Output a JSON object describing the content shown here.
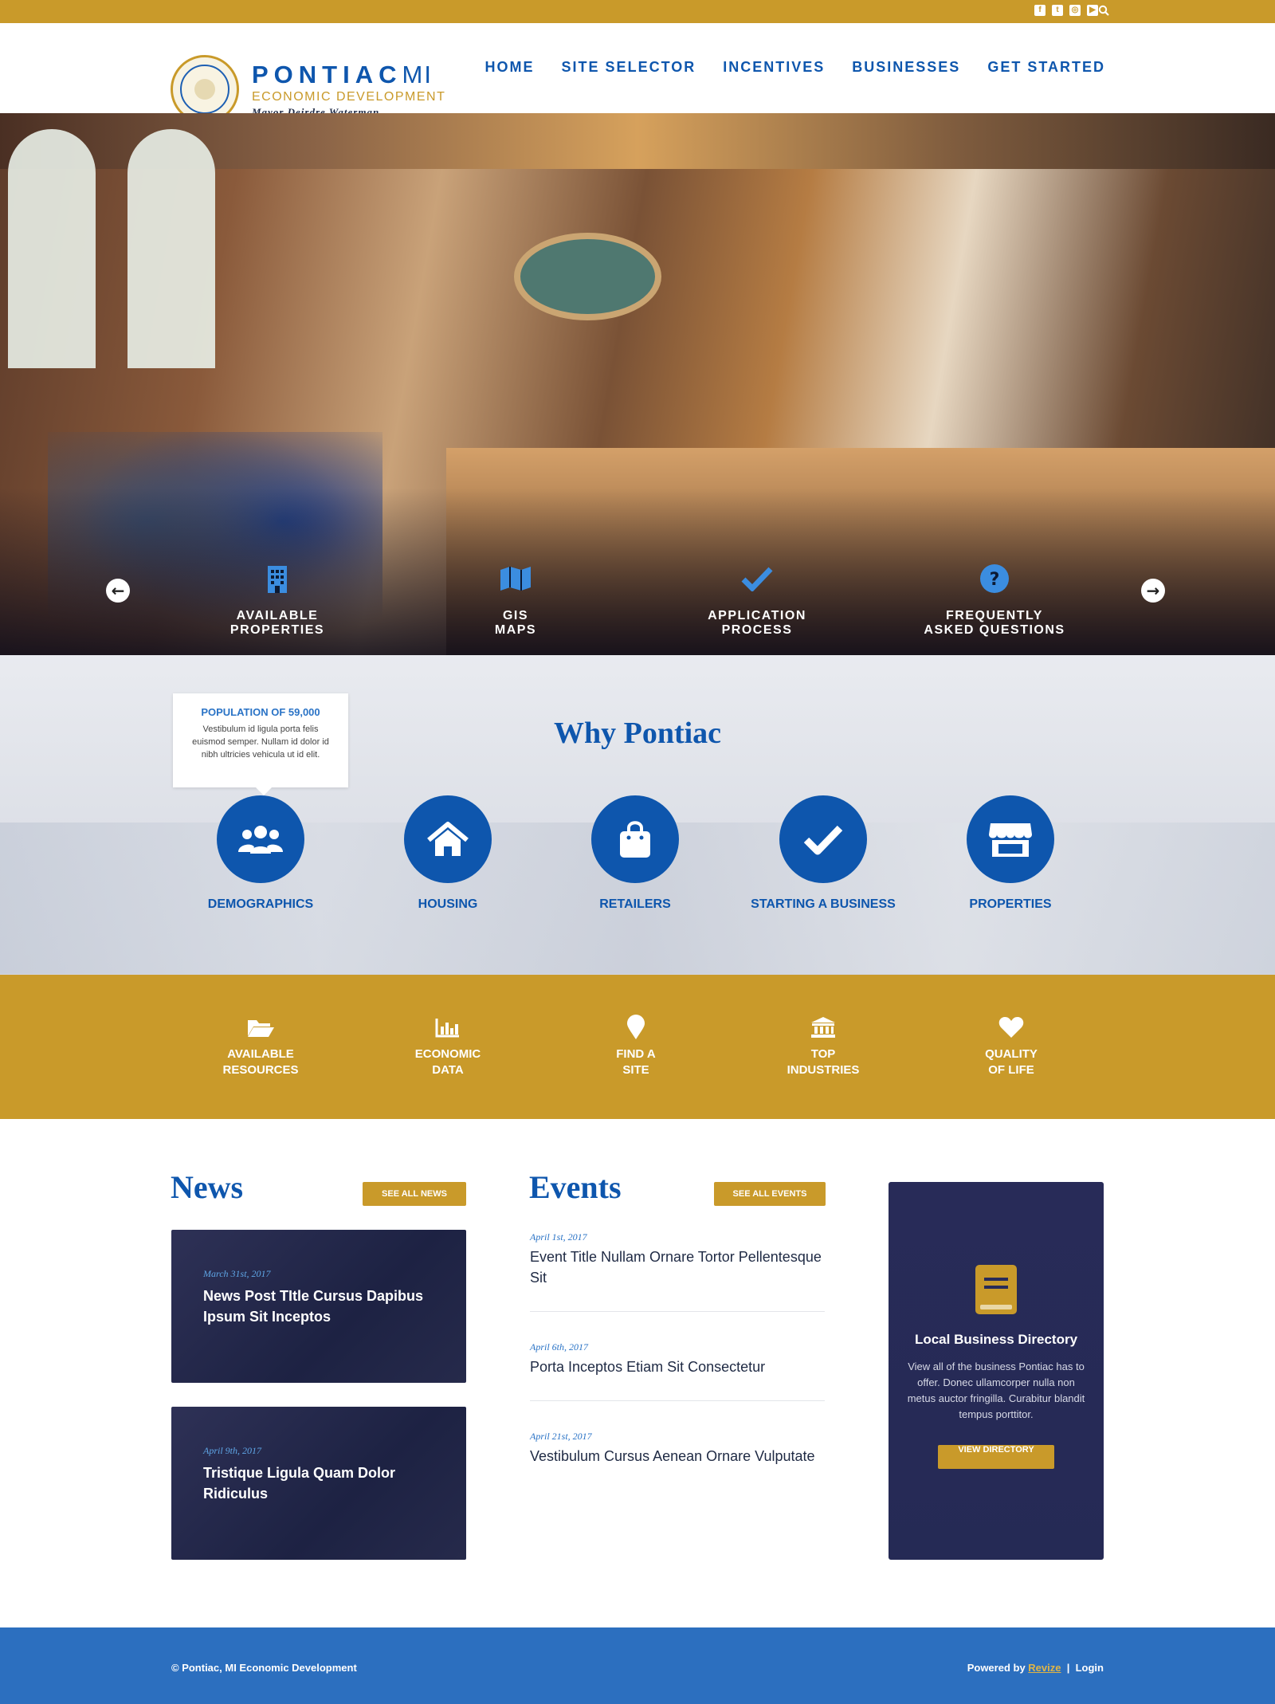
{
  "topbar": {
    "social": [
      "facebook-icon",
      "twitter-icon",
      "instagram-icon",
      "youtube-icon"
    ],
    "search_icon": "search-icon"
  },
  "header": {
    "brand_name": "PONTIAC",
    "brand_suffix": "MI",
    "brand_sub": "ECONOMIC DEVELOPMENT",
    "mayor": "Mayor Deirdre Waterman",
    "seal_alt": "THE CITY OF PONTIAC MICHIGAN"
  },
  "nav": [
    "HOME",
    "SITE SELECTOR",
    "INCENTIVES",
    "BUSINESSES",
    "GET STARTED"
  ],
  "hero_links": [
    {
      "line1": "AVAILABLE",
      "line2": "PROPERTIES",
      "icon": "building-icon"
    },
    {
      "line1": "GIS",
      "line2": "MAPS",
      "icon": "map-icon"
    },
    {
      "line1": "APPLICATION",
      "line2": "PROCESS",
      "icon": "checkmark-icon"
    },
    {
      "line1": "FREQUENTLY",
      "line2": "ASKED QUESTIONS",
      "icon": "question-icon"
    }
  ],
  "why": {
    "title": "Why Pontiac",
    "tooltip_title": "POPULATION OF 59,000",
    "tooltip_text": "Vestibulum id ligula porta felis euismod semper. Nullam id dolor id nibh ultricies vehicula ut id elit.",
    "items": [
      {
        "label": "DEMOGRAPHICS",
        "icon": "users-icon"
      },
      {
        "label": "HOUSING",
        "icon": "home-icon"
      },
      {
        "label": "RETAILERS",
        "icon": "shopping-bag-icon"
      },
      {
        "label": "STARTING A BUSINESS",
        "icon": "check-icon"
      },
      {
        "label": "PROPERTIES",
        "icon": "storefront-icon"
      }
    ]
  },
  "gold_links": [
    {
      "line1": "AVAILABLE",
      "line2": "RESOURCES",
      "icon": "folder-icon"
    },
    {
      "line1": "ECONOMIC",
      "line2": "DATA",
      "icon": "bar-chart-icon"
    },
    {
      "line1": "FIND A",
      "line2": "SITE",
      "icon": "map-pin-icon"
    },
    {
      "line1": "TOP",
      "line2": "INDUSTRIES",
      "icon": "bank-icon"
    },
    {
      "line1": "QUALITY",
      "line2": "OF LIFE",
      "icon": "heart-icon"
    }
  ],
  "news": {
    "title": "News",
    "button": "SEE ALL NEWS",
    "posts": [
      {
        "date": "March 31st, 2017",
        "title": "News Post TItle Cursus Dapibus Ipsum Sit Inceptos"
      },
      {
        "date": "April 9th, 2017",
        "title": "Tristique Ligula Quam Dolor Ridiculus"
      }
    ]
  },
  "events": {
    "title": "Events",
    "button": "SEE ALL EVENTS",
    "items": [
      {
        "date": "April 1st, 2017",
        "title": "Event Title Nullam Ornare Tortor Pellentesque Sit"
      },
      {
        "date": "April 6th, 2017",
        "title": "Porta Inceptos Etiam Sit Consectetur"
      },
      {
        "date": "April 21st, 2017",
        "title": "Vestibulum Cursus Aenean Ornare Vulputate"
      }
    ]
  },
  "directory": {
    "title": "Local Business Directory",
    "text": "View all of the business Pontiac has to offer. Donec ullamcorper nulla non metus auctor fringilla. Curabitur blandit tempus porttitor.",
    "button": "VIEW DIRECTORY"
  },
  "footer": {
    "copyright": "© Pontiac, MI Economic Development",
    "powered_prefix": "Powered by",
    "powered_link": "Revize",
    "separator": "|",
    "login": "Login"
  },
  "colors": {
    "gold": "#c99a2a",
    "blue": "#0e56ad",
    "navy": "#282b58",
    "footer": "#2c6fbf"
  }
}
